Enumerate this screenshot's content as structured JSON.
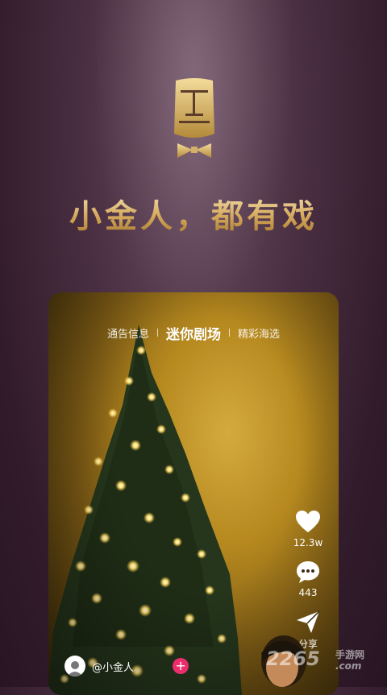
{
  "slogan": "小金人，都有戏",
  "tabs": [
    {
      "label": "通告信息",
      "active": false
    },
    {
      "label": "迷你剧场",
      "active": true
    },
    {
      "label": "精彩海选",
      "active": false
    }
  ],
  "actions": {
    "like_count": "12.3w",
    "comment_count": "443",
    "share_label": "分享"
  },
  "user": {
    "name": "@小金人"
  },
  "watermark": {
    "brand": "2265",
    "sub": "手游网",
    "domain": ".com"
  },
  "colors": {
    "accent": "#e6c98a",
    "follow": "#ea2d6b"
  }
}
